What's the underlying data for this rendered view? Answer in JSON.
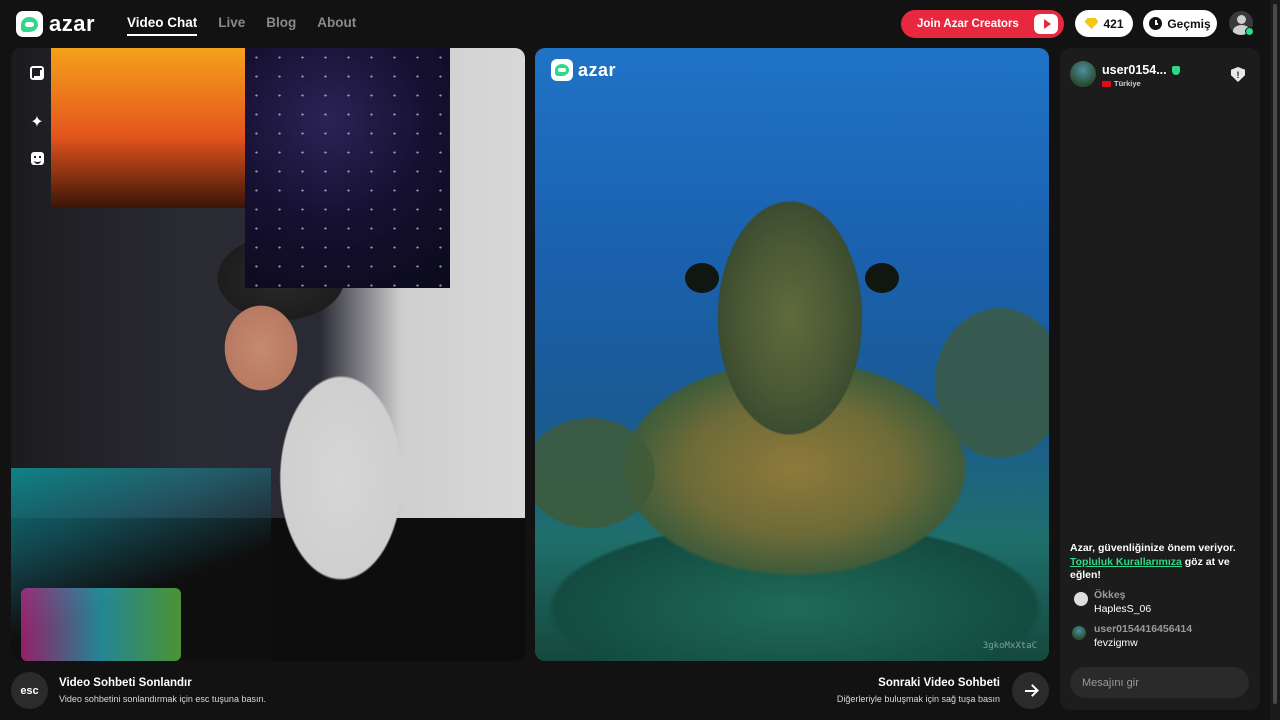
{
  "nav": {
    "logo_text": "azar",
    "links": [
      {
        "label": "Video Chat",
        "active": true
      },
      {
        "label": "Live",
        "active": false
      },
      {
        "label": "Blog",
        "active": false
      },
      {
        "label": "About",
        "active": false
      }
    ]
  },
  "header_actions": {
    "creators_label": "Join Azar Creators",
    "gems_count": "421",
    "history_label": "Geçmiş"
  },
  "video": {
    "remote_logo_text": "azar",
    "watermark": "3gkoMxXtaC"
  },
  "controls": {
    "esc_key": "esc",
    "end_title": "Video Sohbeti Sonlandır",
    "end_hint": "Video sohbetini sonlandırmak için esc tuşuna basın.",
    "next_title": "Sonraki Video Sohbeti",
    "next_hint": "Diğerleriyle buluşmak için sağ tuşa basın"
  },
  "chat": {
    "peer_name": "user0154...",
    "peer_country": "Türkiye",
    "safety_prefix": "Azar, güvenliğinize önem veriyor.",
    "safety_link": "Topluluk Kurallarımıza",
    "safety_suffix": "göz at ve eğlen!",
    "messages": [
      {
        "name": "Ökkeş",
        "text": "HaplesS_06"
      },
      {
        "name": "user0154416456414",
        "text": "fevzigmw"
      }
    ],
    "input_placeholder": "Mesajını gir"
  },
  "colors": {
    "accent_green": "#2fd98a",
    "creators_red": "#e8283f",
    "background": "#121212",
    "chat_panel": "#1c1c1c"
  },
  "icons": [
    "expand-icon",
    "sparkle-icon",
    "face-filter-icon",
    "gem-icon",
    "clock-icon",
    "play-icon",
    "shield-report-icon",
    "arrow-right-icon",
    "verified-icon",
    "flag-icon"
  ]
}
